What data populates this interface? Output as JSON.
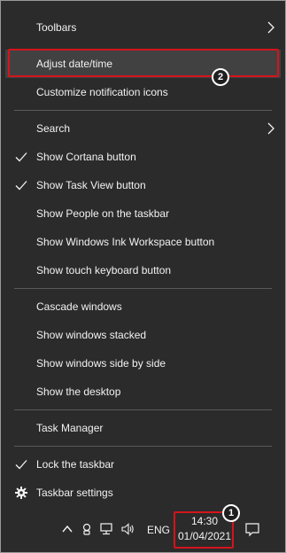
{
  "menu": {
    "items": [
      {
        "label": "Toolbars"
      },
      {
        "label": "Adjust date/time"
      },
      {
        "label": "Customize notification icons"
      },
      {
        "label": "Search"
      },
      {
        "label": "Show Cortana button"
      },
      {
        "label": "Show Task View button"
      },
      {
        "label": "Show People on the taskbar"
      },
      {
        "label": "Show Windows Ink Workspace button"
      },
      {
        "label": "Show touch keyboard button"
      },
      {
        "label": "Cascade windows"
      },
      {
        "label": "Show windows stacked"
      },
      {
        "label": "Show windows side by side"
      },
      {
        "label": "Show the desktop"
      },
      {
        "label": "Task Manager"
      },
      {
        "label": "Lock the taskbar"
      },
      {
        "label": "Taskbar settings"
      }
    ]
  },
  "taskbar": {
    "language": "ENG",
    "time": "14:30",
    "date": "01/04/2021",
    "icons": [
      "chevron-up-icon",
      "meet-now-icon",
      "network-icon",
      "volume-icon",
      "notification-icon"
    ]
  },
  "annotations": {
    "step1": "1",
    "step2": "2"
  },
  "colors": {
    "menu_background": "#2b2b2b",
    "highlight": "#414141",
    "annotation_red": "#d4141b"
  }
}
